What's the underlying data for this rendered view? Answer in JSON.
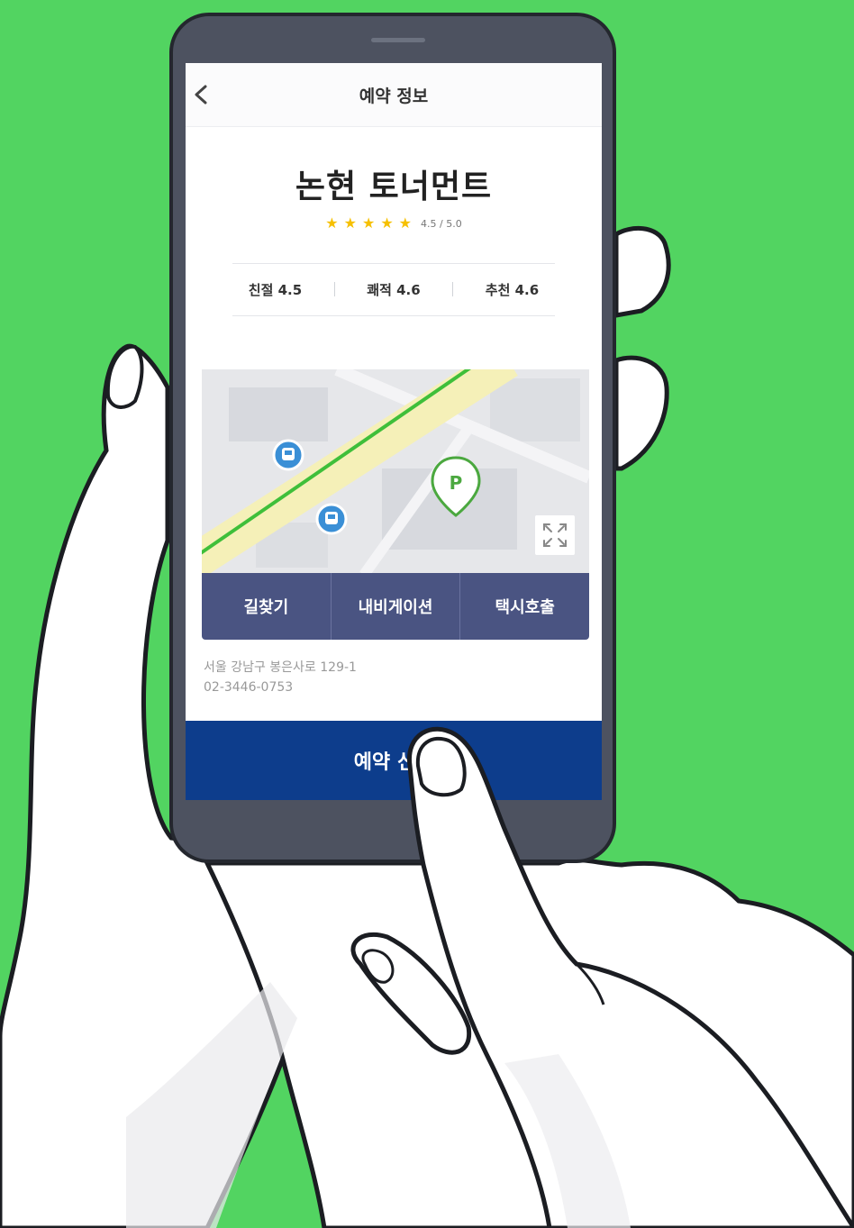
{
  "colors": {
    "background": "#52d461",
    "phone_body": "#4d5260",
    "action_bar": "#4a5482",
    "reserve_button": "#0d3d8c",
    "star": "#f6c000",
    "map_route": "#3fbf3a",
    "map_pin": "#4ba83f",
    "subway_icon": "#3a8fd6"
  },
  "header": {
    "back_icon": "chevron-left-icon",
    "title": "예약 정보"
  },
  "place": {
    "name": "논현 토너먼트",
    "stars": 5,
    "rating_text": "4.5 / 5.0"
  },
  "metrics": [
    {
      "label": "친절 4.5"
    },
    {
      "label": "쾌적 4.6"
    },
    {
      "label": "추천 4.6"
    }
  ],
  "map": {
    "icons": [
      "subway-icon",
      "subway-icon",
      "parking-pin-icon",
      "expand-icon"
    ]
  },
  "actions": [
    {
      "label": "길찾기"
    },
    {
      "label": "내비게이션"
    },
    {
      "label": "택시호출"
    }
  ],
  "address": {
    "line": "서울 강남구 봉은사로 129-1",
    "phone": "02-3446-0753"
  },
  "reserve_button": {
    "label": "예약 신청"
  }
}
